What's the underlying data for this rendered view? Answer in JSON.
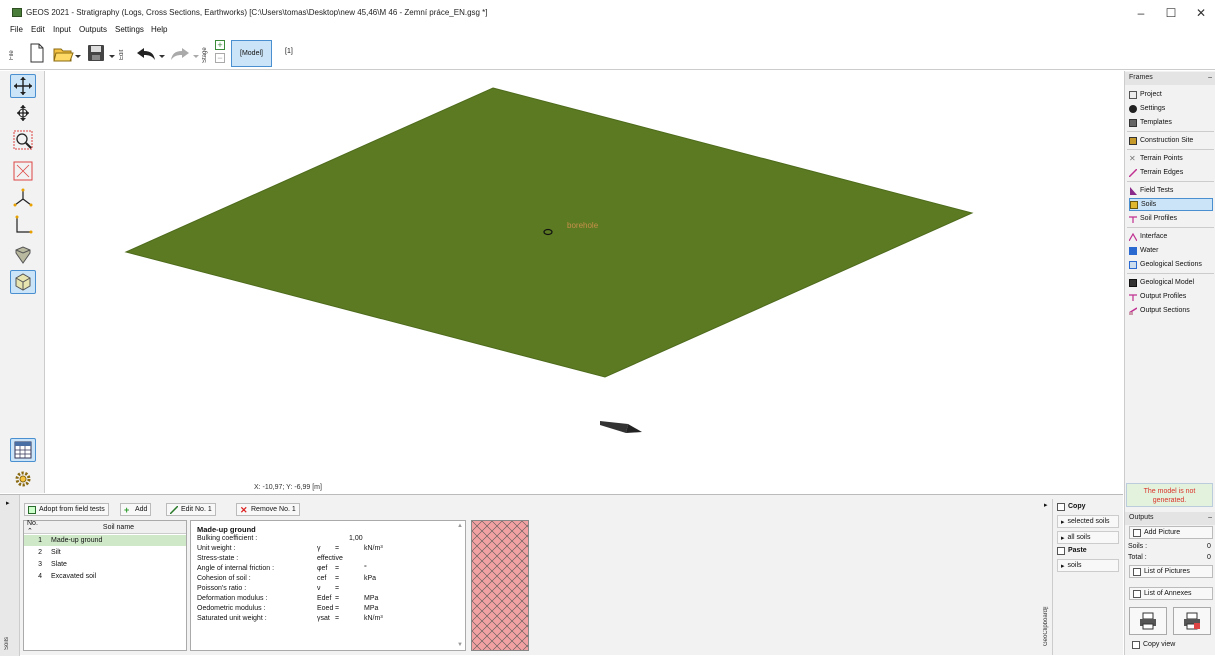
{
  "window": {
    "title": "GEOS 2021 - Stratigraphy (Logs, Cross Sections, Earthworks) [C:\\Users\\tomas\\Desktop\\new 45,46\\M 46 - Zemní práce_EN.gsg *]"
  },
  "menu": [
    "File",
    "Edit",
    "Input",
    "Outputs",
    "Settings",
    "Help"
  ],
  "toolbar": {
    "file_tab": "File",
    "edit_tab": "Edit",
    "stage_tab": "Stage",
    "model_button": "[Model]",
    "stage_number": "[1]"
  },
  "canvas": {
    "label": "borehole",
    "coords": "X: -10,97; Y: -6,99 [m]",
    "terrain_color": "#5c7a22"
  },
  "frames": {
    "header": "Frames",
    "items": [
      {
        "label": "Project",
        "icon": "project-icon"
      },
      {
        "label": "Settings",
        "icon": "settings-icon"
      },
      {
        "label": "Templates",
        "icon": "templates-icon"
      },
      {
        "label": "Construction Site",
        "icon": "construction-site-icon"
      },
      {
        "label": "Terrain Points",
        "icon": "terrain-points-icon"
      },
      {
        "label": "Terrain Edges",
        "icon": "terrain-edges-icon"
      },
      {
        "label": "Field Tests",
        "icon": "field-tests-icon"
      },
      {
        "label": "Soils",
        "icon": "soils-icon"
      },
      {
        "label": "Soil Profiles",
        "icon": "soil-profiles-icon"
      },
      {
        "label": "Interface",
        "icon": "interface-icon"
      },
      {
        "label": "Water",
        "icon": "water-icon"
      },
      {
        "label": "Geological Sections",
        "icon": "geological-sections-icon"
      },
      {
        "label": "Geological Model",
        "icon": "geological-model-icon"
      },
      {
        "label": "Output Profiles",
        "icon": "output-profiles-icon"
      },
      {
        "label": "Output Sections",
        "icon": "output-sections-icon"
      }
    ]
  },
  "status_message": "The model is not generated.",
  "outputs": {
    "header": "Outputs",
    "add_picture": "Add Picture",
    "soils_label": "Soils :",
    "soils_value": "0",
    "total_label": "Total :",
    "total_value": "0",
    "list_pictures": "List of Pictures",
    "list_annexes": "List of Annexes",
    "copy_view": "Copy view"
  },
  "soils_panel": {
    "side_tab": "Soils",
    "buttons": {
      "adopt": "Adopt from field tests",
      "add": "Add",
      "edit": "Edit No. 1",
      "remove": "Remove No. 1"
    },
    "columns": {
      "no": "No.",
      "name": "Soil name"
    },
    "rows": [
      {
        "no": "1",
        "name": "Made-up ground"
      },
      {
        "no": "2",
        "name": "Silt"
      },
      {
        "no": "3",
        "name": "Slate"
      },
      {
        "no": "4",
        "name": "Excavated soil"
      }
    ],
    "selected": 0
  },
  "properties": {
    "title": "Made-up ground",
    "rows": [
      {
        "label": "Bulking coefficient :",
        "symbol": "",
        "eq": "",
        "value": "1,00",
        "unit": ""
      },
      {
        "label": "Unit weight :",
        "symbol": "γ",
        "eq": "=",
        "value": "",
        "unit": "kN/m³"
      },
      {
        "label": "Stress-state :",
        "symbol": "",
        "eq": "",
        "value": "effective",
        "unit": ""
      },
      {
        "label": "Angle of internal friction :",
        "symbol": "φef",
        "eq": "=",
        "value": "",
        "unit": "°"
      },
      {
        "label": "Cohesion of soil :",
        "symbol": "cef",
        "eq": "=",
        "value": "",
        "unit": "kPa"
      },
      {
        "label": "Poisson's ratio :",
        "symbol": "ν",
        "eq": "=",
        "value": "",
        "unit": ""
      },
      {
        "label": "Deformation modulus :",
        "symbol": "Edef",
        "eq": "=",
        "value": "",
        "unit": "MPa"
      },
      {
        "label": "Oedometric modulus :",
        "symbol": "Eoed",
        "eq": "=",
        "value": "",
        "unit": "MPa"
      },
      {
        "label": "Saturated unit weight :",
        "symbol": "γsat",
        "eq": "=",
        "value": "",
        "unit": "kN/m³"
      }
    ]
  },
  "clipboard": {
    "copy": "Copy",
    "selected_soils": "selected soils",
    "all_soils": "all soils",
    "paste": "Paste",
    "soils": "soils",
    "side_tab": "GeoClipboard™"
  }
}
